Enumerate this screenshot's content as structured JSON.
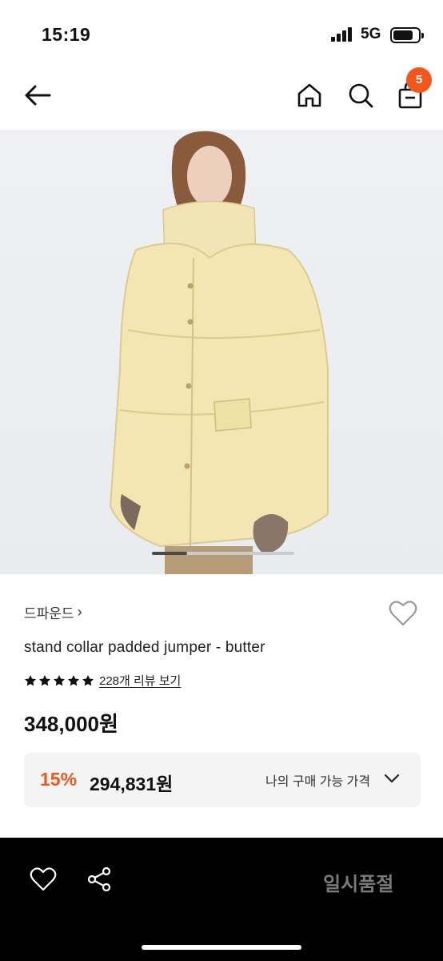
{
  "status": {
    "time": "15:19",
    "network": "5G"
  },
  "header": {
    "back_icon": "arrow-left-icon",
    "home_icon": "home-icon",
    "search_icon": "search-icon",
    "bag_icon": "shopping-bag-icon",
    "cart_count": "5",
    "badge_color": "#f0561e"
  },
  "gallery": {
    "image": "model wearing butter padded jumper"
  },
  "product": {
    "brand": "드파운드",
    "brand_chevron": "›",
    "title": "stand collar padded jumper - butter",
    "rating_stars": 5,
    "review_link": "228개 리뷰 보기",
    "price": "348,000원"
  },
  "discount": {
    "rate": "15%",
    "price": "294,831원",
    "my_price_label": "나의 구매 가능 가격",
    "accent": "#f0561e"
  },
  "bottom_bar": {
    "like_icon": "heart-icon",
    "share_icon": "share-icon",
    "soldout_label": "일시품절"
  }
}
